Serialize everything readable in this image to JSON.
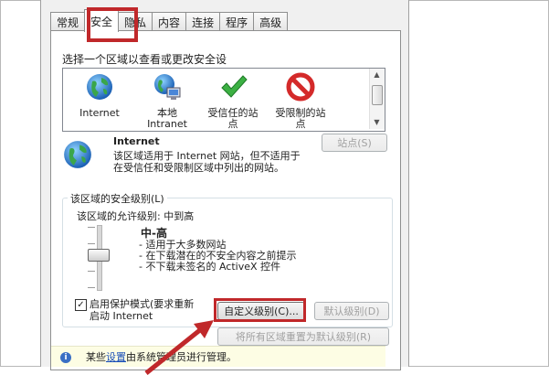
{
  "tabs": [
    {
      "label": "常规",
      "active": false
    },
    {
      "label": "安全",
      "active": true
    },
    {
      "label": "隐私",
      "active": false
    },
    {
      "label": "内容",
      "active": false
    },
    {
      "label": "连接",
      "active": false
    },
    {
      "label": "程序",
      "active": false
    },
    {
      "label": "高级",
      "active": false
    }
  ],
  "zone_prompt": "选择一个区域以查看或更改安全设",
  "zones": [
    {
      "label": "Internet",
      "icon": "globe-icon"
    },
    {
      "label": "本地\nIntranet",
      "icon": "intranet-icon"
    },
    {
      "label": "受信任的站\n点",
      "icon": "trusted-sites-icon"
    },
    {
      "label": "受限制的站\n点",
      "icon": "restricted-sites-icon"
    }
  ],
  "selected_zone": {
    "title": "Internet",
    "description": "该区域适用于 Internet 网站，但不适用于\n在受信任和受限制区域中列出的网站。",
    "sites_button": "站点(S)"
  },
  "security_level": {
    "legend": "该区域的安全级别(L)",
    "allowed": "该区域的允许级别: 中到高",
    "level_name": "中-高",
    "level_description": "- 适用于大多数网站\n- 在下载潜在的不安全内容之前提示\n- 不下载未签名的 ActiveX 控件",
    "protected_mode_label": "启用保护模式(要求重新\n启动 Internet",
    "protected_mode_checked": true,
    "custom_level_button": "自定义级别(C)...",
    "default_level_button": "默认级别(D)",
    "reset_all_button": "将所有区域重置为默认级别(R)"
  },
  "info_bar": {
    "prefix": "某些",
    "link": "设置",
    "suffix": "由系统管理员进行管理。"
  },
  "colors": {
    "highlight": "#c0282a",
    "accent_blue": "#1a4fb8"
  }
}
